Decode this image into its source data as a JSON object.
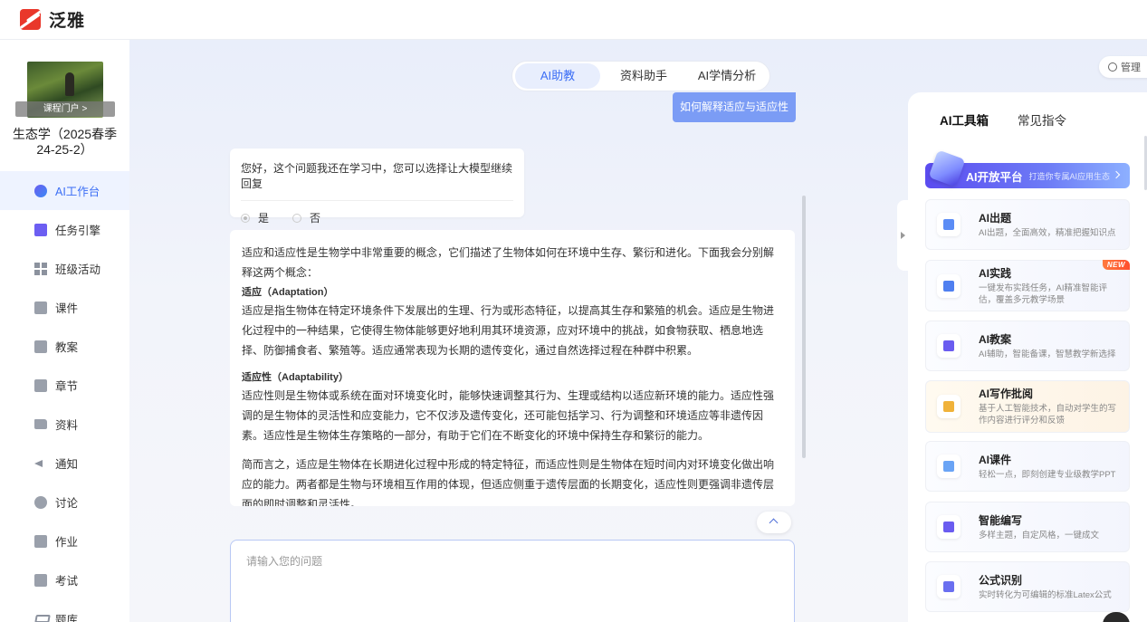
{
  "brand": {
    "name": "泛雅"
  },
  "course": {
    "portal_label": "课程门户 >",
    "title": "生态学（2025春季 24-25-2）"
  },
  "nav": [
    {
      "label": "AI工作台",
      "icon": "ai-icon",
      "active": true
    },
    {
      "label": "任务引擎",
      "icon": "task-icon",
      "active": false
    },
    {
      "label": "班级活动",
      "icon": "grid-icon",
      "active": false
    },
    {
      "label": "课件",
      "icon": "file-icon",
      "active": false
    },
    {
      "label": "教案",
      "icon": "document-icon",
      "active": false
    },
    {
      "label": "章节",
      "icon": "list-icon",
      "active": false
    },
    {
      "label": "资料",
      "icon": "folder-icon",
      "active": false
    },
    {
      "label": "通知",
      "icon": "speaker-icon",
      "active": false
    },
    {
      "label": "讨论",
      "icon": "chat-icon",
      "active": false
    },
    {
      "label": "作业",
      "icon": "edit-icon",
      "active": false
    },
    {
      "label": "考试",
      "icon": "exam-icon",
      "active": false
    },
    {
      "label": "题库",
      "icon": "stack-icon",
      "active": false
    }
  ],
  "tabs": [
    {
      "label": "AI助教",
      "active": true
    },
    {
      "label": "资料助手",
      "active": false
    },
    {
      "label": "AI学情分析",
      "active": false
    }
  ],
  "manage_label": "管理",
  "chat": {
    "user_question": "如何解释适应与适应性",
    "bot_prompt": "您好，这个问题我还在学习中，您可以选择让大模型继续回复",
    "option_yes": "是",
    "option_no": "否",
    "answer": {
      "intro": "适应和适应性是生物学中非常重要的概念，它们描述了生物体如何在环境中生存、繁衍和进化。下面我会分别解释这两个概念：",
      "h1": "适应（Adaptation）",
      "p1": "适应是指生物体在特定环境条件下发展出的生理、行为或形态特征，以提高其生存和繁殖的机会。适应是生物进化过程中的一种结果，它使得生物体能够更好地利用其环境资源，应对环境中的挑战，如食物获取、栖息地选择、防御捕食者、繁殖等。适应通常表现为长期的遗传变化，通过自然选择过程在种群中积累。",
      "h2": "适应性（Adaptability）",
      "p2": "适应性则是生物体或系统在面对环境变化时，能够快速调整其行为、生理或结构以适应新环境的能力。适应性强调的是生物体的灵活性和应变能力，它不仅涉及遗传变化，还可能包括学习、行为调整和环境适应等非遗传因素。适应性是生物体生存策略的一部分，有助于它们在不断变化的环境中保持生存和繁衍的能力。",
      "p3": "简而言之，适应是生物体在长期进化过程中形成的特定特征，而适应性则是生物体在短时间内对环境变化做出响应的能力。两者都是生物与环境相互作用的体现，但适应侧重于遗传层面的长期变化，适应性则更强调非遗传层面的即时调整和灵活性。"
    },
    "input_placeholder": "请输入您的问题"
  },
  "right_panel": {
    "tabs": [
      {
        "label": "AI工具箱",
        "active": true
      },
      {
        "label": "常见指令",
        "active": false
      }
    ],
    "banner": {
      "title": "AI开放平台",
      "subtitle": "打造你专属AI应用生态"
    },
    "tools": [
      {
        "name": "AI出题",
        "desc": "AI出题，全面高效，精准把握知识点",
        "icon": "quiz-icon",
        "color": "#5b8cf5"
      },
      {
        "name": "AI实践",
        "desc": "一键发布实践任务，AI精准智能评估，覆盖多元教学场景",
        "icon": "practice-icon",
        "color": "#4f7ff0",
        "badge": "NEW"
      },
      {
        "name": "AI教案",
        "desc": "AI辅助，智能备课，智慧教学新选择",
        "icon": "lesson-plan-icon",
        "color": "#6a5cf0"
      },
      {
        "name": "AI写作批阅",
        "desc": "基于人工智能技术，自动对学生的写作内容进行评分和反馈",
        "icon": "writing-review-icon",
        "color": "#f0b23a",
        "warm": true
      },
      {
        "name": "AI课件",
        "desc": "轻松一点，即刻创建专业级教学PPT",
        "icon": "ppt-icon",
        "color": "#6aa4f5"
      },
      {
        "name": "智能编写",
        "desc": "多样主题，自定风格，一键成文",
        "icon": "writing-icon",
        "color": "#6a5cf0"
      },
      {
        "name": "公式识别",
        "desc": "实时转化为可编辑的标准Latex公式",
        "icon": "formula-icon",
        "color": "#6a6ff0"
      }
    ]
  }
}
